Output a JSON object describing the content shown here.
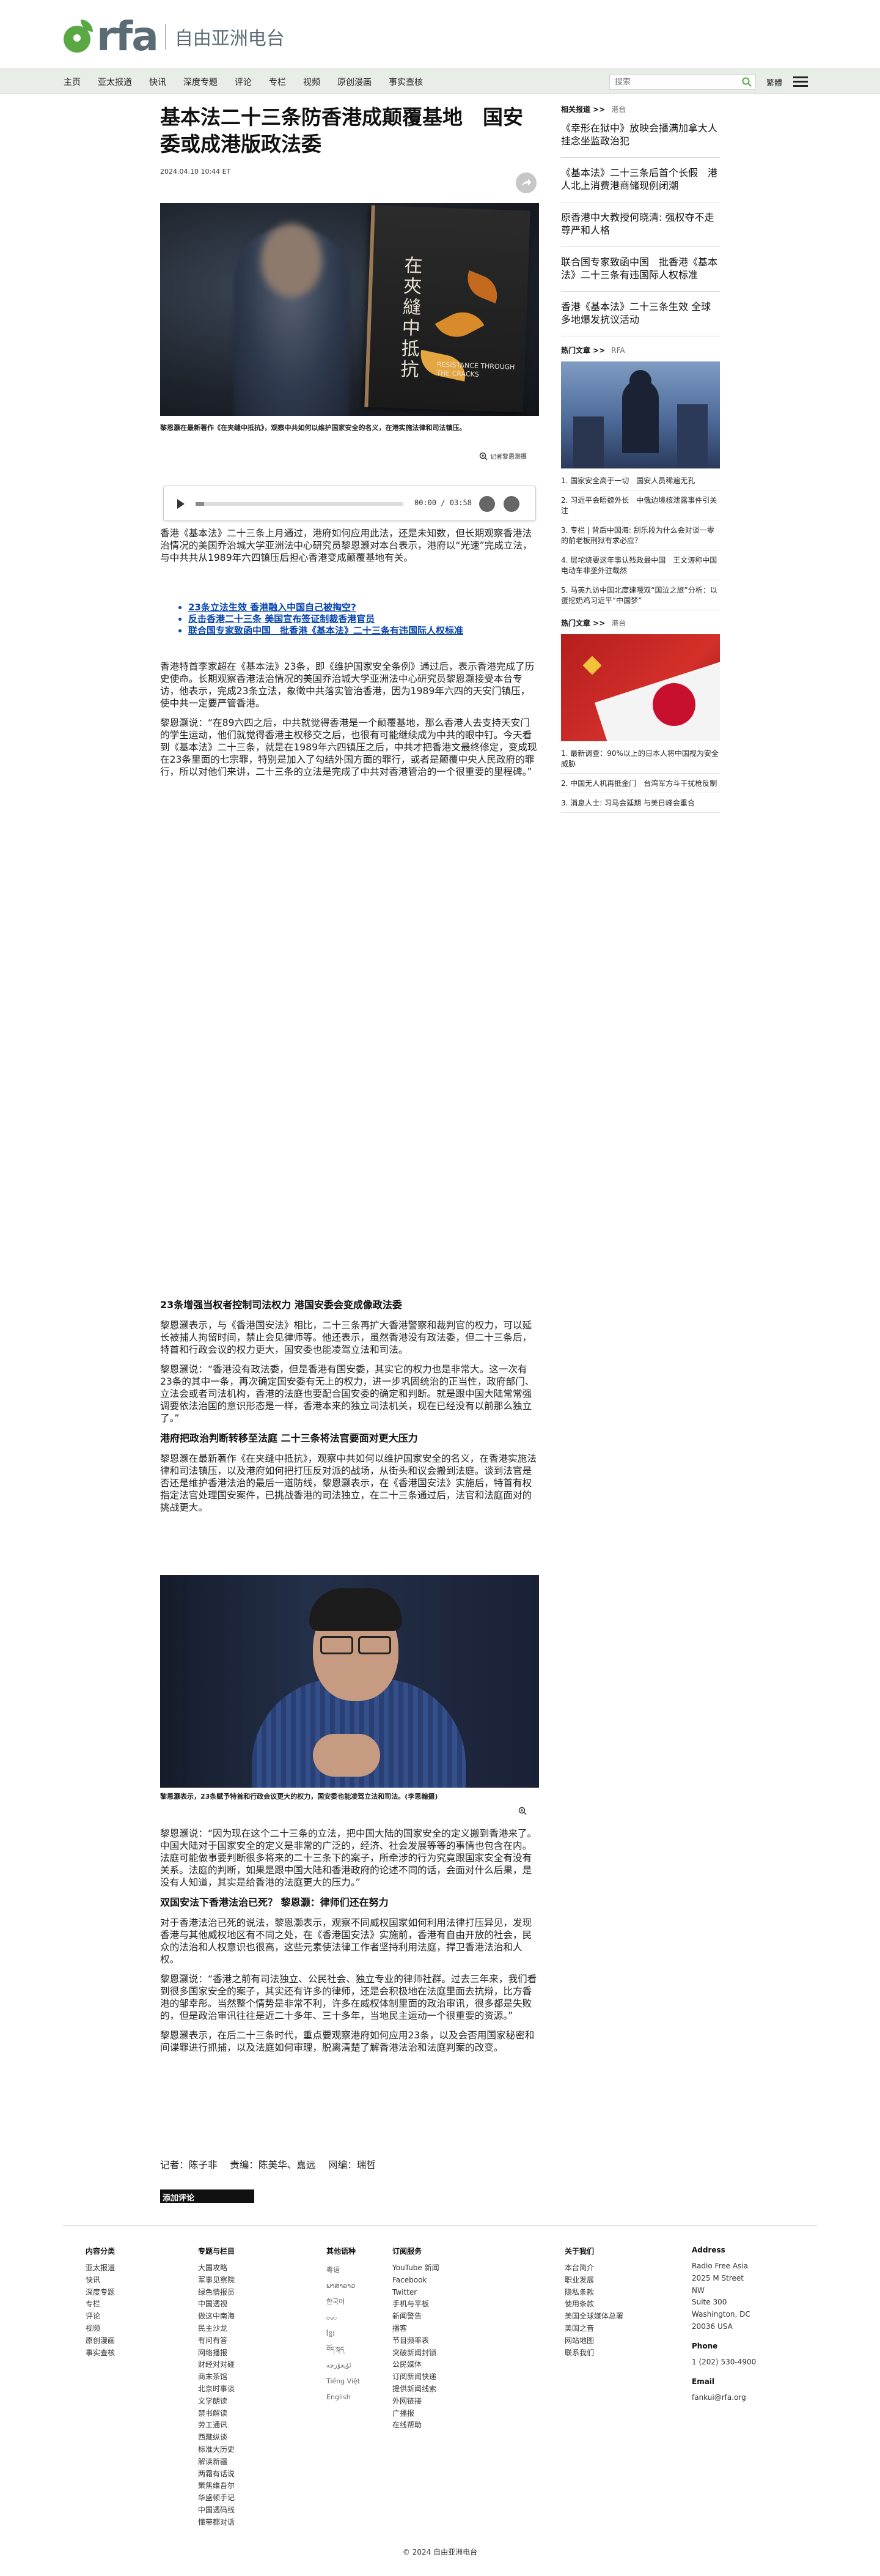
{
  "brand": {
    "logo_text": "rfa",
    "name_cn": "自由亚洲电台"
  },
  "nav": {
    "items": [
      "主页",
      "亚太报道",
      "快讯",
      "深度专题",
      "评论",
      "专栏",
      "视频",
      "原创漫画",
      "事实查核"
    ],
    "search_placeholder": "搜索",
    "lang_toggle": "繁體"
  },
  "article": {
    "headline": "基本法二十三条防香港成颠覆基地　国安委或成港版政法委",
    "date": "2024.04.10 10:44 ET",
    "hero_caption": "黎恩灏在最新著作《在夹缝中抵抗》，观察中共如何以维护国家安全的名义，在港实施法律和司法镇压。",
    "hero_book_title": "在夾縫中抵抗",
    "hero_book_en": "RESISTANCE THROUGH THE CRACKS",
    "zoom_label": "记者黎恩灏摄",
    "audio": {
      "time": "00:00 / 03:58",
      "progress": 0.04
    },
    "paragraph1": "香港《基本法》二十三条上月通过，港府如何应用此法，还是未知数，但长期观察香港法治情况的美国乔治城大学亚洲法中心研究员黎恩灏对本台表示，港府以“光速”完成立法，与中共共从1989年六四镇压后担心香港变成颠覆基地有关。",
    "related": [
      "23条立法生效 香港融入中国自己被掏空?",
      "反击香港二十三条 美国宣布签证制裁香港官员",
      "联合国专家致函中国　批香港《基本法》二十三条有违国际人权标准"
    ],
    "paragraph2": "香港特首李家超在《基本法》23条，即《维护国家安全条例》通过后，表示香港完成了历史使命。长期观察香港法治情况的美国乔治城大学亚洲法中心研究员黎恩灏接受本台专访，他表示，完成23条立法，象徵中共落实管治香港，因为1989年六四的天安门镇压，使中共一定要严管香港。",
    "paragraph3": "黎恩灏说：“在89六四之后，中共就觉得香港是一个颠覆基地，那么香港人去支持天安门的学生运动，他们就觉得香港主权移交之后，也很有可能继续成为中共的眼中钉。今天看到《基本法》二十三条，就是在1989年六四镇压之后，中共才把香港文最终修定，变成现在23条里面的七宗罪，特别是加入了勾结外国方面的罪行，或者是颠覆中央人民政府的罪行，所以对他们来讲，二十三条的立法是完成了中共对香港管治的一个很重要的里程碑。”",
    "subhead1": "23条增强当权者控制司法权力 港国安委会变成像政法委",
    "paragraph4": "黎恩灏表示，与《香港国安法》相比，二十三条再扩大香港警察和裁判官的权力，可以延长被捕人拘留时间，禁止会见律师等。他还表示，虽然香港没有政法委，但二十三条后，特首和行政会议的权力更大，国安委也能凌驾立法和司法。",
    "paragraph5": "黎恩灏说：“香港没有政法委，但是香港有国安委，其实它的权力也是非常大。这一次有23条的其中一条，再次确定国安委有无上的权力，进一步巩固统治的正当性，政府部门、立法会或者司法机构，香港的法庭也要配合国安委的确定和判断。就是跟中国大陆常常强调要依法治国的意识形态是一样，香港本来的独立司法机关，现在已经没有以前那么独立了。”",
    "subhead2": "港府把政治判断转移至法庭 二十三条将法官要面对更大压力",
    "paragraph6": "黎恩灏在最新著作《在夹缝中抵抗》，观察中共如何以维护国家安全的名义，在香港实施法律和司法镇压，以及港府如何把打压反对派的战场，从街头和议会搬到法庭。谈到法官是否还是维护香港法治的最后一道防线，黎恩灏表示，在《香港国安法》实施后，特首有权指定法官处理国安案件，已挑战香港的司法独立，在二十三条通过后，法官和法庭面对的挑战更大。",
    "photo2_caption": "黎恩灏表示，23条赋予特首和行政会议更大的权力，国安委也能凌驾立法和司法。(李思翰摄)",
    "paragraph7": "黎恩灏说：“因为现在这个二十三条的立法，把中国大陆的国家安全的定义搬到香港来了。中国大陆对于国家安全的定义是非常的广泛的，经济、社会发展等等的事情也包含在内。法庭可能做事要判断很多将来的二十三条下的案子，所牵涉的行为究竟跟国家安全有没有关系。法庭的判断，如果是跟中国大陆和香港政府的论述不同的话，会面对什么后果，是没有人知道，其实是给香港的法庭更大的压力。”",
    "subhead3": "双国安法下香港法治已死？ 黎恩灏：律师们还在努力",
    "paragraph8": "对于香港法治已死的说法，黎恩灏表示，观察不同威权国家如何利用法律打压异见，发现香港与其他威权地区有不同之处，在《香港国安法》实施前，香港有自由开放的社会，民众的法治和人权意识也很高，这些元素使法律工作者坚持利用法庭，捍卫香港法治和人权。",
    "paragraph9": "黎恩灏说：“香港之前有司法独立、公民社会、独立专业的律师社群。过去三年来，我们看到很多国家安全的案子，其实还有许多的律师，还是会积极地在法庭里面去抗辩，比方香港的邹幸彤。当然整个情势是非常不利，许多在威权体制里面的政治审讯，很多都是失败的，但是政治审讯往往是近二十多年、三十多年，当地民主运动一个很重要的资源。”",
    "paragraph10": "黎恩灏表示，在后二十三条时代，重点要观察港府如何应用23条，以及会否用国家秘密和间谍罪进行抓捕，以及法庭如何审理，脱离清楚了解香港法治和法庭判案的改变。",
    "byline": "记者：陈子非　 责编：陈美华、嘉远　 网编：瑞哲",
    "comment_button": "添加评论"
  },
  "sidebar": {
    "related_head": "相关报道 >>",
    "related_sub": "港台",
    "related_stories": [
      "《幸形在狱中》放映会播满加拿大人挂念坐监政治犯",
      "《基本法》二十三条后首个长假　港人北上消费港商储现例闭潮",
      "原香港中大教授何晓清: 强权夺不走尊严和人格",
      "联合国专家致函中国　批香港《基本法》二十三条有违国际人权标准",
      "香港《基本法》二十三条生效 全球多地爆发抗议活动"
    ],
    "hot1_head": "热门文章 >>",
    "hot1_sub": "RFA",
    "hot1_list": [
      "1. 国家安全高于一切　国安人员稀遍无孔",
      "2. 习近平会晤魏外长　中俄边境核泄露事件引关注",
      "3. 专栏 | 背后中国海: 刮乐段为什么会对谈一零的前老板刑狱有求必应？",
      "4. 层坨烧要这年事认残政最中国　王文涛称中国电动车非垄外驻载然",
      "5. 马英九访中国北度建哦双“国泣之旅”分析：以蛋挖奶鸡习近平“中国梦”"
    ],
    "hot2_head": "热门文章 >>",
    "hot2_sub": "港台",
    "hot2_list": [
      "1. 最新调查：90%以上的日本人将中国视为安全威胁",
      "2. 中国无人机再抵金门　台湾军方斗干扰枪反制",
      "3. 消息人士: 习马会延期 与美日峰会重合"
    ]
  },
  "footer": {
    "col1": {
      "head": "内容分类",
      "items": [
        "亚太报道",
        "快讯",
        "深度专题",
        "专栏",
        "评论",
        "视频",
        "原创漫画",
        "事实查核"
      ]
    },
    "col2": {
      "head": "专题与栏目",
      "items": [
        "大国攻略",
        "军事见察院",
        "绿色情报员",
        "中国透视",
        "做这中南海",
        "民主沙龙",
        "有问有答",
        "网络播报",
        "财经对对碰",
        "商末茶馆",
        "北京时事谈",
        "文学朗读",
        "禁书解读",
        "劳工通讯",
        "西藏纵谈",
        "标准大历史",
        "解读新疆",
        "两霜有话说",
        "聚焦维吾尔",
        "华盛顿手记",
        "中国透码线",
        "懂带都对话"
      ]
    },
    "col3": {
      "head": "其他语种",
      "items": [
        "粵语",
        "ພາສາລາວ",
        "한국어",
        "ဗမာ",
        "ខ្មែរ",
        "བོད་སྐད",
        "ئۇيغۇرچە",
        "Tiếng Việt",
        "English"
      ]
    },
    "col4": {
      "head": "订阅服务",
      "items": [
        "YouTube 新闻",
        "Facebook",
        "Twitter",
        "手机与平板",
        "新闻警告",
        "播客",
        "节目频率表",
        "突破新闻封锁",
        "公民媒体",
        "订阅新闻快递",
        "提供新闻线索",
        "外网链接",
        "广播报",
        "在线帮助"
      ]
    },
    "col5": {
      "head": "关于我们",
      "items": [
        "本台简介",
        "职业发展",
        "隐私条款",
        "使用条款",
        "美国全球媒体总署",
        "美国之音",
        "网站地图",
        "联系我们"
      ]
    },
    "col6": {
      "head": "Address",
      "items": [
        "Radio Free Asia",
        "2025 M Street NW",
        "Suite 300",
        "Washington, DC",
        "20036 USA"
      ],
      "phone_head": "Phone",
      "phone": "1 (202) 530-4900",
      "email_head": "Email",
      "email": "fankui@rfa.org"
    }
  },
  "copyright": "© 2024 自由亚洲电台",
  "colors": {
    "brand_green": "#5aa843",
    "link_blue": "#0645ad",
    "nav_bg": "#e8ede7"
  }
}
